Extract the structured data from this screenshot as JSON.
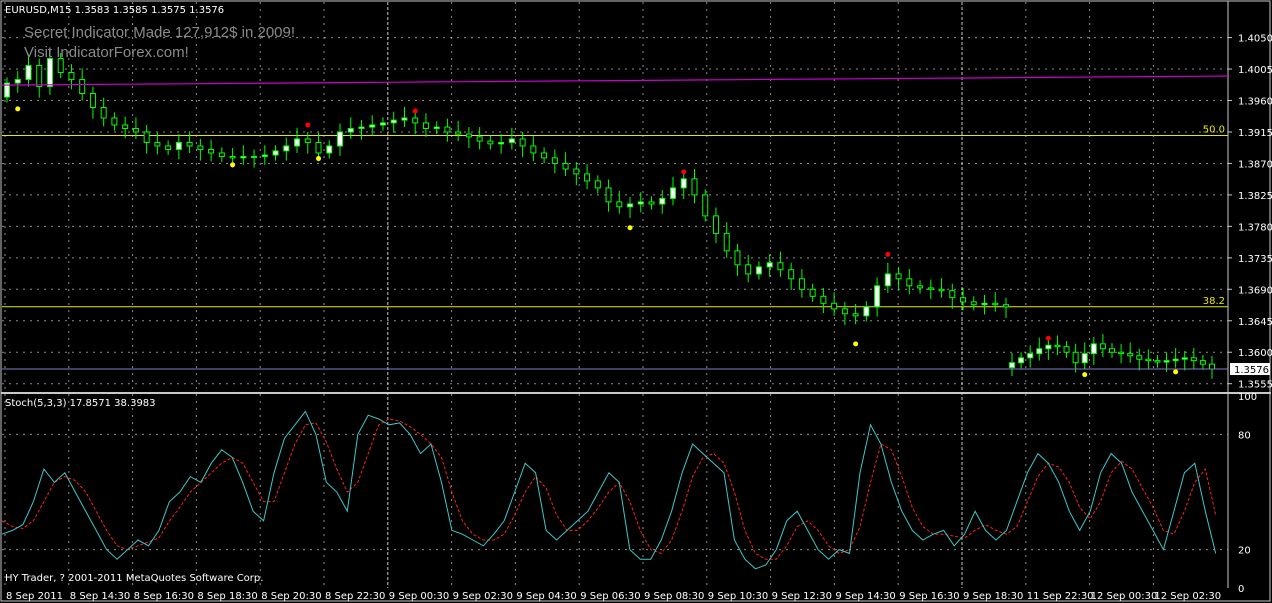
{
  "window": {
    "symbol_header": "EURUSD,M15  1.3583 1.3585 1.3575 1.3576",
    "watermark_line1": "Secret Indicator Made 127,912$ in 2009!",
    "watermark_line2": "Visit IndicatorForex.com!",
    "indicator_header": "Stoch(5,3,3) 17.8571 38.3983",
    "footer": "HY Trader, ? 2001-2011 MetaQuotes Software Corp."
  },
  "colors": {
    "background": "#000000",
    "grid": "#c8c8c8",
    "bull_candle": "#ffffff",
    "bear_candle": "#00ff00",
    "ma_line": "#cc00cc",
    "fib_line": "#e8e800",
    "current_price_line": "#7f7fcc",
    "stoch_main": "#3fc8c8",
    "stoch_signal": "#ff2020",
    "fractal_up": "#ff0000",
    "fractal_down": "#ffff00"
  },
  "chart_data": [
    {
      "type": "candlestick",
      "symbol": "EURUSD",
      "timeframe": "M15",
      "ohlc_header": {
        "open": 1.3583,
        "high": 1.3585,
        "low": 1.3575,
        "close": 1.3576
      },
      "ylim": [
        1.3546,
        1.4078
      ],
      "y_ticks": [
        "1.4050",
        "1.4005",
        "1.3960",
        "1.3915",
        "1.3870",
        "1.3825",
        "1.3780",
        "1.3735",
        "1.3690",
        "1.3645",
        "1.3600",
        "1.3555"
      ],
      "x_ticks": [
        "8 Sep 2011",
        "8 Sep 14:30",
        "8 Sep 16:30",
        "8 Sep 18:30",
        "8 Sep 20:30",
        "8 Sep 22:30",
        "9 Sep 00:30",
        "9 Sep 02:30",
        "9 Sep 04:30",
        "9 Sep 06:30",
        "9 Sep 08:30",
        "9 Sep 10:30",
        "9 Sep 12:30",
        "9 Sep 14:30",
        "9 Sep 16:30",
        "9 Sep 18:30",
        "11 Sep 22:30",
        "12 Sep 00:30",
        "12 Sep 02:30"
      ],
      "period_separators_after_tick": [
        6,
        15
      ],
      "close_path": [
        1.3985,
        1.399,
        1.401,
        1.398,
        1.402,
        1.4,
        1.399,
        1.397,
        1.395,
        1.3935,
        1.3925,
        1.392,
        1.3915,
        1.39,
        1.3895,
        1.389,
        1.39,
        1.3895,
        1.389,
        1.3885,
        1.388,
        1.3878,
        1.388,
        1.388,
        1.3882,
        1.3888,
        1.3895,
        1.3905,
        1.39,
        1.3885,
        1.3895,
        1.3915,
        1.392,
        1.3922,
        1.3925,
        1.3928,
        1.3932,
        1.3935,
        1.3928,
        1.392,
        1.3922,
        1.3915,
        1.3912,
        1.3908,
        1.3902,
        1.3898,
        1.39,
        1.3905,
        1.3895,
        1.3885,
        1.3878,
        1.387,
        1.3862,
        1.3855,
        1.3845,
        1.3835,
        1.3815,
        1.3808,
        1.3812,
        1.3815,
        1.3812,
        1.382,
        1.3835,
        1.3848,
        1.3825,
        1.3795,
        1.377,
        1.3745,
        1.3725,
        1.3712,
        1.3722,
        1.3728,
        1.3718,
        1.3705,
        1.369,
        1.368,
        1.367,
        1.3662,
        1.3655,
        1.3652,
        1.3665,
        1.3695,
        1.3712,
        1.3705,
        1.3695,
        1.3692,
        1.369,
        1.3688,
        1.3678,
        1.3672,
        1.3668,
        1.367,
        1.3668,
        1.3665,
        1.3585,
        1.3592,
        1.3598,
        1.3605,
        1.361,
        1.3608,
        1.36,
        1.3585,
        1.3598,
        1.3612,
        1.3605,
        1.36,
        1.3598,
        1.3595,
        1.359,
        1.3588,
        1.3586,
        1.3588,
        1.359,
        1.3592,
        1.3588,
        1.3583,
        1.3576
      ],
      "moving_average": {
        "start": 1.3982,
        "end": 1.3995
      },
      "fibonacci_levels": [
        {
          "label": "50.0",
          "price": 1.391
        },
        {
          "label": "38.2",
          "price": 1.3665
        }
      ],
      "current_price": {
        "label": "1.3576",
        "price": 1.3576
      },
      "fractals_up": [
        {
          "bar": 28,
          "price": 1.3925
        },
        {
          "bar": 38,
          "price": 1.3945
        },
        {
          "bar": 63,
          "price": 1.3858
        },
        {
          "bar": 82,
          "price": 1.374
        },
        {
          "bar": 98,
          "price": 1.362
        }
      ],
      "fractals_down": [
        {
          "bar": 1,
          "price": 1.3948
        },
        {
          "bar": 21,
          "price": 1.3868
        },
        {
          "bar": 29,
          "price": 1.3877
        },
        {
          "bar": 58,
          "price": 1.3778
        },
        {
          "bar": 79,
          "price": 1.3612
        },
        {
          "bar": 102,
          "price": 1.3568
        },
        {
          "bar": 112,
          "price": 1.3572
        }
      ]
    },
    {
      "type": "line",
      "indicator": "Stochastic",
      "params": "5,3,3",
      "ylim": [
        0,
        100
      ],
      "y_ticks": [
        "100",
        "80",
        "20",
        "0"
      ],
      "levels": [
        80,
        20
      ],
      "main": [
        28,
        30,
        33,
        45,
        62,
        55,
        60,
        50,
        40,
        30,
        20,
        15,
        20,
        25,
        22,
        30,
        45,
        50,
        58,
        55,
        65,
        72,
        68,
        55,
        40,
        35,
        60,
        78,
        85,
        92,
        80,
        55,
        50,
        40,
        80,
        90,
        88,
        85,
        86,
        80,
        70,
        75,
        55,
        30,
        28,
        25,
        22,
        28,
        35,
        50,
        65,
        60,
        30,
        25,
        30,
        35,
        40,
        50,
        60,
        55,
        20,
        15,
        15,
        25,
        40,
        60,
        75,
        70,
        65,
        60,
        25,
        15,
        10,
        12,
        20,
        35,
        40,
        30,
        20,
        15,
        20,
        18,
        60,
        85,
        75,
        55,
        40,
        30,
        25,
        28,
        30,
        22,
        28,
        40,
        30,
        25,
        30,
        45,
        60,
        70,
        65,
        55,
        40,
        30,
        40,
        60,
        70,
        65,
        50,
        40,
        30,
        20,
        40,
        60,
        65,
        40,
        18
      ],
      "signal": [
        35,
        32,
        31,
        35,
        45,
        55,
        58,
        56,
        50,
        40,
        30,
        22,
        20,
        22,
        24,
        26,
        35,
        42,
        50,
        55,
        60,
        65,
        68,
        65,
        55,
        45,
        45,
        60,
        75,
        85,
        86,
        76,
        62,
        50,
        55,
        70,
        85,
        88,
        87,
        84,
        80,
        75,
        68,
        50,
        35,
        28,
        25,
        25,
        28,
        38,
        50,
        58,
        52,
        38,
        30,
        30,
        35,
        42,
        50,
        55,
        45,
        30,
        20,
        18,
        25,
        40,
        58,
        68,
        70,
        65,
        50,
        30,
        18,
        15,
        15,
        22,
        32,
        35,
        30,
        22,
        18,
        20,
        32,
        55,
        75,
        72,
        58,
        42,
        32,
        28,
        28,
        27,
        26,
        30,
        33,
        30,
        28,
        32,
        45,
        58,
        65,
        63,
        55,
        42,
        36,
        45,
        60,
        66,
        62,
        52,
        42,
        30,
        28,
        40,
        55,
        62,
        38
      ]
    }
  ]
}
